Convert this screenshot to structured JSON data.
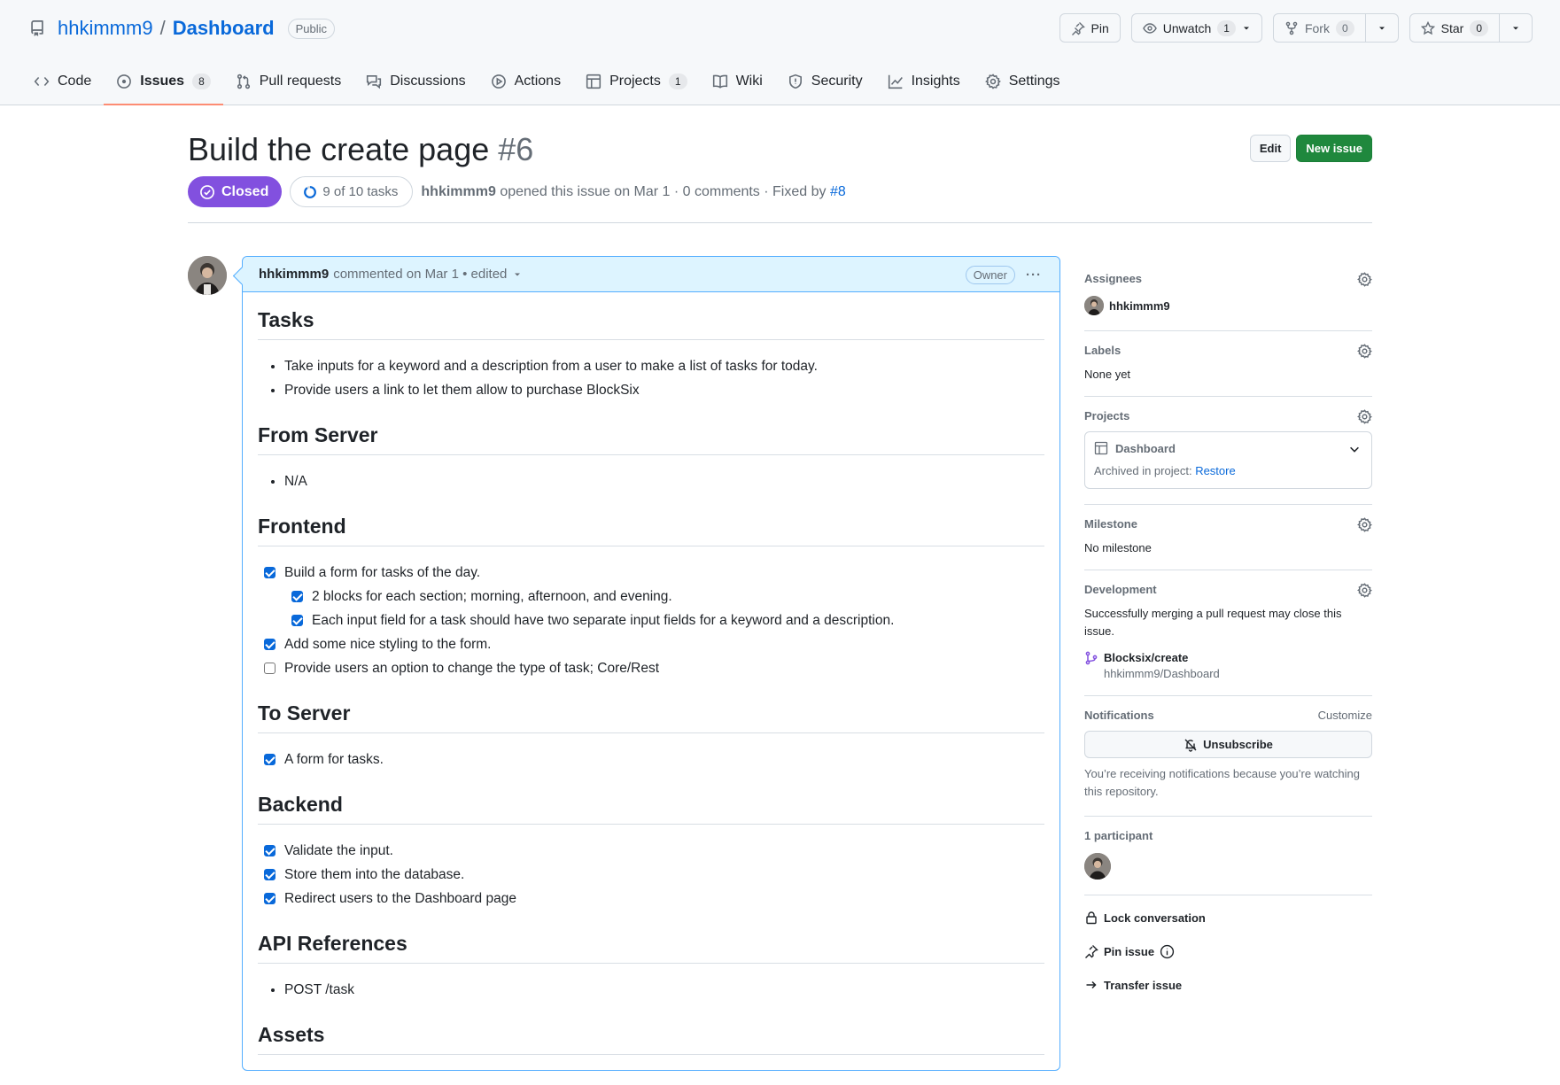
{
  "repo": {
    "owner": "hhkimmm9",
    "separator": "/",
    "name": "Dashboard",
    "visibility": "Public",
    "icon": "repo-icon"
  },
  "repo_actions": {
    "pin_label": "Pin",
    "unwatch_label": "Unwatch",
    "unwatch_count": "1",
    "fork_label": "Fork",
    "fork_count": "0",
    "star_label": "Star",
    "star_count": "0"
  },
  "nav": {
    "code": "Code",
    "issues": "Issues",
    "issues_count": "8",
    "pull_requests": "Pull requests",
    "discussions": "Discussions",
    "actions": "Actions",
    "projects": "Projects",
    "projects_count": "1",
    "wiki": "Wiki",
    "security": "Security",
    "insights": "Insights",
    "settings": "Settings"
  },
  "issue": {
    "title": "Build the create page",
    "number": "#6",
    "edit_label": "Edit",
    "new_issue_label": "New issue",
    "state": "Closed",
    "tasks_progress": "9 of 10 tasks",
    "author": "hhkimmm9",
    "opened_text": "opened this issue on Mar 1 · 0 comments · Fixed by",
    "fixed_by": "#8"
  },
  "comment": {
    "author": "hhkimmm9",
    "meta": "commented on Mar 1 • edited",
    "role": "Owner",
    "menu": "···",
    "sections": {
      "tasks": {
        "heading": "Tasks",
        "items": [
          "Take inputs for a keyword and a description from a user to make a list of tasks for today.",
          "Provide users a link to let them allow to purchase BlockSix"
        ]
      },
      "from_server": {
        "heading": "From Server",
        "items": [
          "N/A"
        ]
      },
      "frontend": {
        "heading": "Frontend",
        "items": [
          {
            "text": "Build a form for tasks of the day.",
            "checked": true
          },
          {
            "text": "2 blocks for each section; morning, afternoon, and evening.",
            "checked": true
          },
          {
            "text": "Each input field for a task should have two separate input fields for a keyword and a description.",
            "checked": true
          },
          {
            "text": "Add some nice styling to the form.",
            "checked": true
          },
          {
            "text": "Provide users an option to change the type of task; Core/Rest",
            "checked": false
          }
        ]
      },
      "to_server": {
        "heading": "To Server",
        "items": [
          {
            "text": "A form for tasks.",
            "checked": true
          }
        ]
      },
      "backend": {
        "heading": "Backend",
        "items": [
          {
            "text": "Validate the input.",
            "checked": true
          },
          {
            "text": "Store them into the database.",
            "checked": true
          },
          {
            "text": "Redirect users to the Dashboard page",
            "checked": true
          }
        ]
      },
      "api_references": {
        "heading": "API References",
        "items": [
          "POST /task"
        ]
      },
      "assets": {
        "heading": "Assets"
      }
    }
  },
  "sidebar": {
    "assignees": {
      "title": "Assignees",
      "user": "hhkimmm9"
    },
    "labels": {
      "title": "Labels",
      "value": "None yet"
    },
    "projects": {
      "title": "Projects",
      "project_name": "Dashboard",
      "archived_text": "Archived in project:",
      "restore_label": "Restore"
    },
    "milestone": {
      "title": "Milestone",
      "value": "No milestone"
    },
    "development": {
      "title": "Development",
      "text": "Successfully merging a pull request may close this issue.",
      "branch": "Blocksix/create",
      "branch_repo": "hhkimmm9/Dashboard"
    },
    "notifications": {
      "title": "Notifications",
      "customize_label": "Customize",
      "unsubscribe_label": "Unsubscribe",
      "note": "You’re receiving notifications because you’re watching this repository."
    },
    "participants": {
      "title": "1 participant"
    },
    "actions": {
      "lock": "Lock conversation",
      "pin": "Pin issue",
      "transfer": "Transfer issue"
    }
  },
  "colors": {
    "accent_link": "#0969da",
    "closed_purple": "#8250df",
    "new_issue_green": "#1f883d",
    "nav_active_underline": "#fd8c73",
    "comment_header_bg": "#ddf4ff"
  }
}
